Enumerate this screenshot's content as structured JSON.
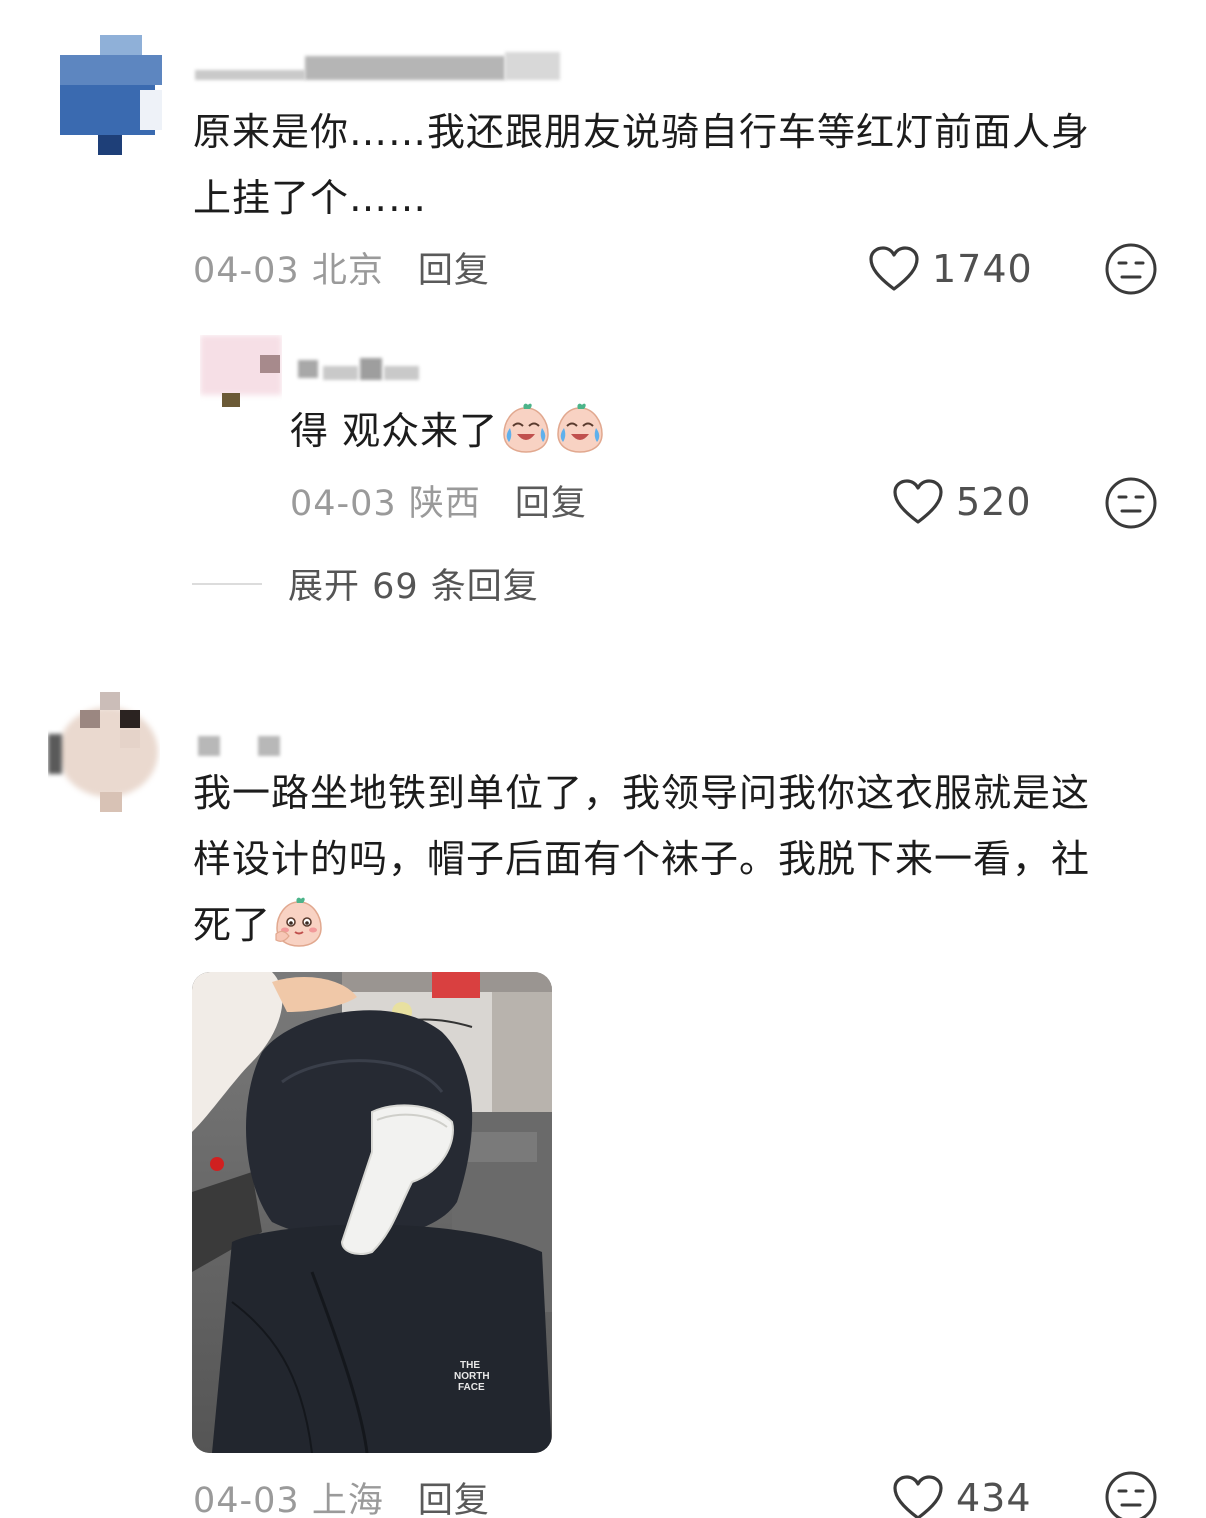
{
  "comments": [
    {
      "text_line1": "原来是你……我还跟朋友说骑自行车等红灯前面人身",
      "text_line2": "上挂了个……",
      "time_location": "04-03 北京",
      "reply_label": "回复",
      "likes": "1740"
    },
    {
      "text": "得 观众来了",
      "time_location": "04-03 陕西",
      "reply_label": "回复",
      "likes": "520"
    },
    {
      "text_line1": "我一路坐地铁到单位了，我领导问我你这衣服就是这",
      "text_line2": "样设计的吗，帽子后面有个袜子。我脱下来一看，社",
      "text_line3": "死了",
      "time_location": "04-03 上海",
      "reply_label": "回复",
      "likes": "434"
    }
  ],
  "expand_replies": "展开 69 条回复",
  "photo": {
    "logo_text": "THE NORTH FACE",
    "logo_line1": "THE",
    "logo_line2": "NORTH",
    "logo_line3": "FACE"
  },
  "icons": {
    "like": "heart-outline-icon",
    "dislike": "meh-face-icon",
    "emoji_cry_laugh": "crying-laughing-emoji",
    "emoji_blush": "blushing-emoji"
  },
  "colors": {
    "meta_gray": "#9a9a9a",
    "text": "#1c1c1c",
    "icon": "#3a3a3a"
  }
}
